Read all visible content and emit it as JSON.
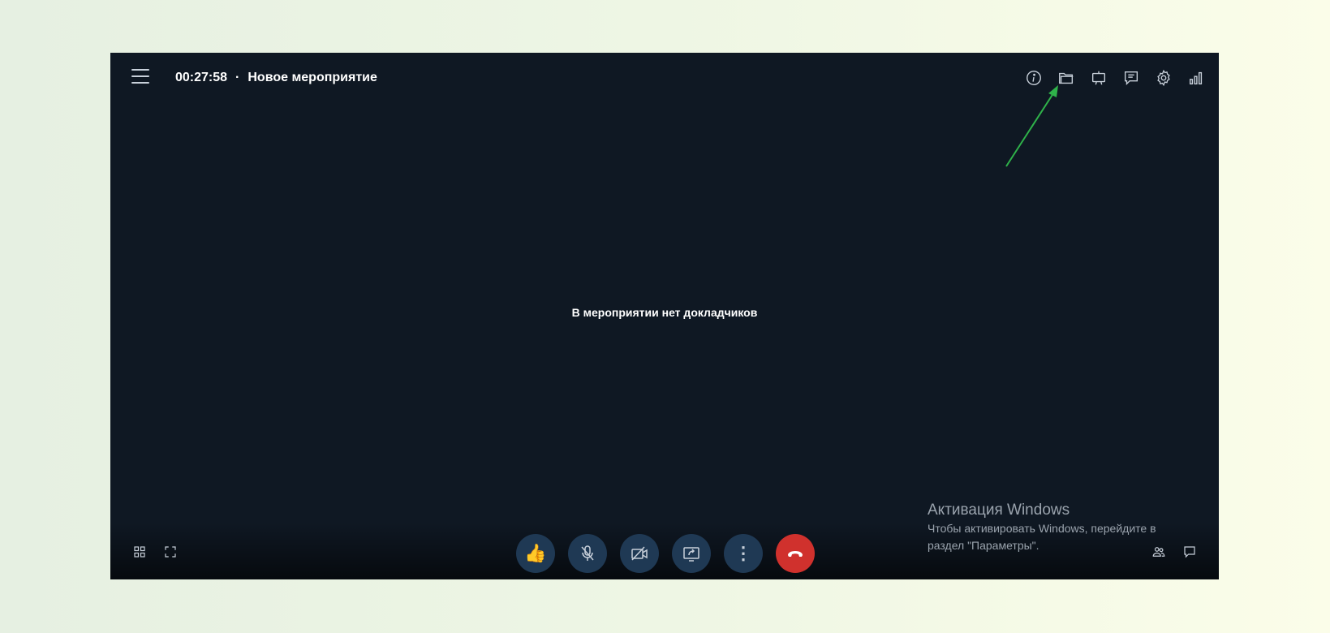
{
  "header": {
    "timer": "00:27:58",
    "separator": "·",
    "event_title": "Новое мероприятие",
    "icons": [
      "info-icon",
      "folder-icon",
      "presentation-icon",
      "chat-list-icon",
      "gear-icon",
      "signal-icon"
    ]
  },
  "main": {
    "empty_message": "В мероприятии нет докладчиков"
  },
  "controls": {
    "buttons": [
      "thumbs-up-icon",
      "microphone-muted-icon",
      "camera-off-icon",
      "share-screen-icon",
      "more-icon",
      "hang-up-icon"
    ],
    "thumb_emoji": "👍",
    "more_glyph": "⋮"
  },
  "bottom_left": [
    "grid-view-icon",
    "fullscreen-icon"
  ],
  "bottom_right": [
    "participants-icon",
    "chat-icon"
  ],
  "watermark": {
    "title": "Активация Windows",
    "subtitle": "Чтобы активировать Windows, перейдите в раздел \"Параметры\"."
  },
  "colors": {
    "background": "#0f1823",
    "control_button": "#1f3954",
    "hangup": "#d0312d",
    "annotation_arrow": "#2fb24a"
  }
}
